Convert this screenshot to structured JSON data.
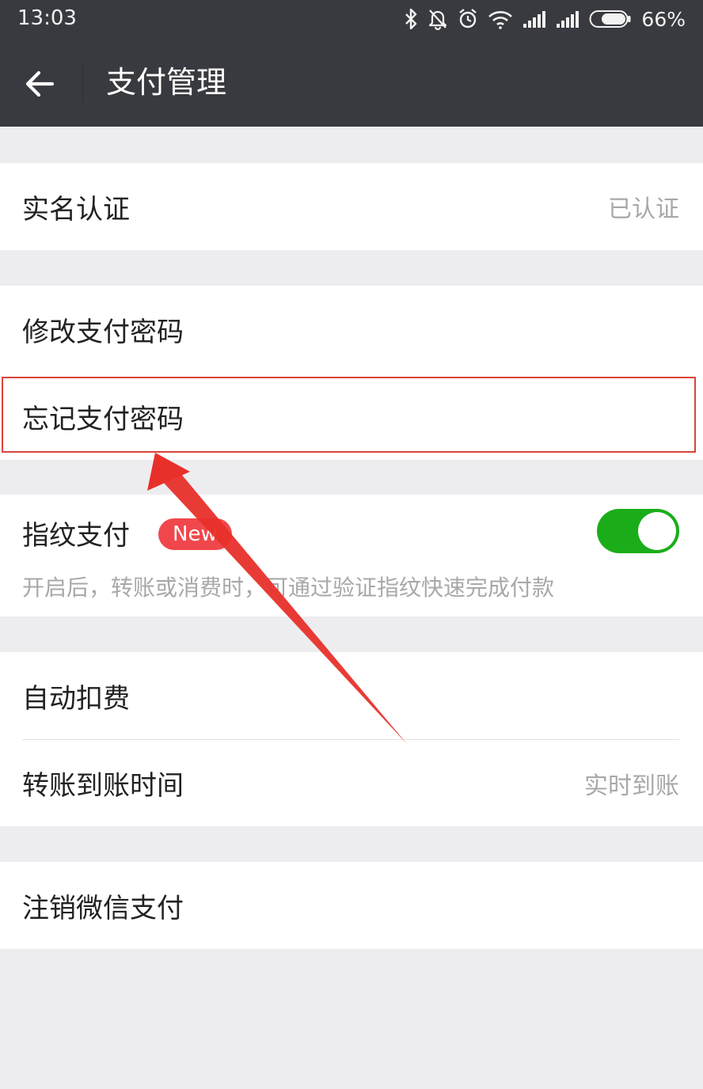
{
  "status_bar": {
    "time": "13:03",
    "battery_percent": "66%",
    "icons": [
      "bluetooth-icon",
      "mute-icon",
      "alarm-icon",
      "wifi-icon",
      "signal-icon",
      "signal-icon",
      "battery-icon"
    ]
  },
  "header": {
    "title": "支付管理",
    "back_icon": "back-arrow-icon",
    "background": "#393a3f"
  },
  "sections": {
    "real_name": {
      "label": "实名认证",
      "value": "已认证"
    },
    "password": {
      "change_label": "修改支付密码",
      "forgot_label": "忘记支付密码"
    },
    "fingerprint": {
      "label": "指纹支付",
      "badge": "New",
      "toggle_on": true,
      "description": "开启后，转账或消费时，可通过验证指纹快速完成付款"
    },
    "transfer": {
      "auto_deduct_label": "自动扣费",
      "arrival_time_label": "转账到账时间",
      "arrival_time_value": "实时到账"
    },
    "cancel": {
      "label": "注销微信支付"
    }
  },
  "colors": {
    "toggle_green": "#1aad19",
    "badge_red": "#f0474c",
    "annotation_red": "#e8302a"
  }
}
